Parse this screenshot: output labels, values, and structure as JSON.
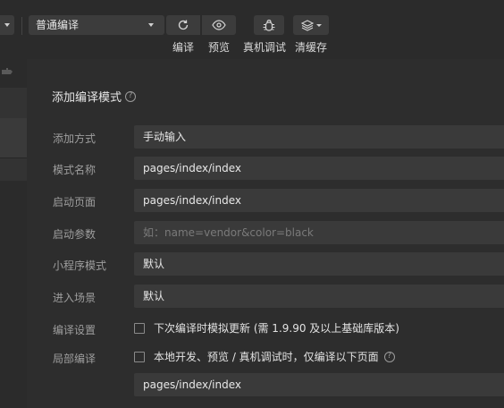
{
  "toolbar": {
    "compile_mode": "普通编译",
    "compile_label": "编译",
    "preview_label": "预览",
    "debug_label": "真机调试",
    "clear_cache_label": "清缓存"
  },
  "panel": {
    "title": "添加编译模式",
    "rows": {
      "add_method": {
        "label": "添加方式",
        "value": "手动输入"
      },
      "mode_name": {
        "label": "模式名称",
        "value": "pages/index/index"
      },
      "start_page": {
        "label": "启动页面",
        "value": "pages/index/index"
      },
      "start_params": {
        "label": "启动参数",
        "value": "",
        "placeholder": "如：name=vendor&color=black"
      },
      "miniapp_mode": {
        "label": "小程序模式",
        "value": "默认"
      },
      "scene": {
        "label": "进入场景",
        "value": "默认"
      },
      "compile_settings": {
        "label": "编译设置",
        "option": "下次编译时模拟更新 (需 1.9.90 及以上基础库版本)",
        "checked": false
      },
      "partial_compile": {
        "label": "局部编译",
        "option": "本地开发、预览 / 真机调试时，仅编译以下页面",
        "checked": false,
        "page": "pages/index/index"
      }
    }
  }
}
